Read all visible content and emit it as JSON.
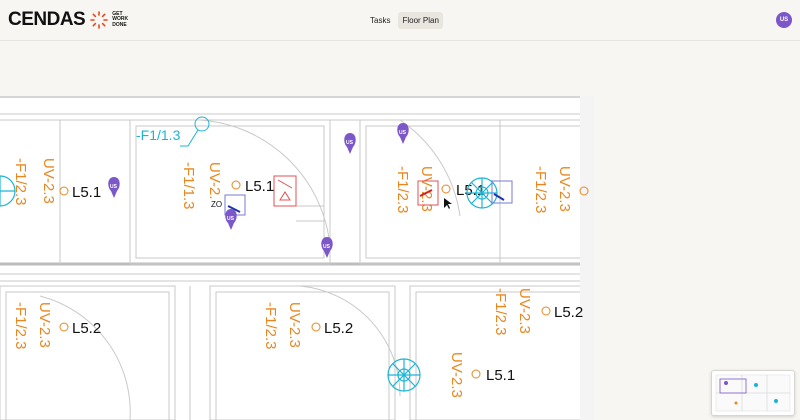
{
  "app": {
    "logo_text": "CENDAS",
    "logo_tagline": "GET WORK DONE",
    "tabs": [
      {
        "label": "Tasks",
        "active": false
      },
      {
        "label": "Floor Plan",
        "active": true
      }
    ],
    "user_initials": "US"
  },
  "floorplan": {
    "grid_label": "-F1/1.3",
    "rooms": [
      "L5.1",
      "L5.1",
      "L5.1",
      "L5.1",
      "L5.2",
      "L5.2",
      "L5.2",
      "L5.1"
    ],
    "vertical_labels": [
      "UV-2.3",
      "-F1/2.3",
      "UV-2.",
      "-F1/1.3",
      "-F1/2.3",
      "UV-2.3",
      "UV-2.3",
      "-F1/2.3",
      "UV-2.3",
      "-F1/2.3",
      "UV-2.3",
      "-F1/2.3",
      "UV-2.3",
      "-F1/2.3",
      "UV-2.3"
    ],
    "small_label": "ZO",
    "pin_label": "US",
    "accent_orange": "#e8871e",
    "accent_cyan": "#1cb4d4",
    "pin_color": "#7b57c9"
  }
}
